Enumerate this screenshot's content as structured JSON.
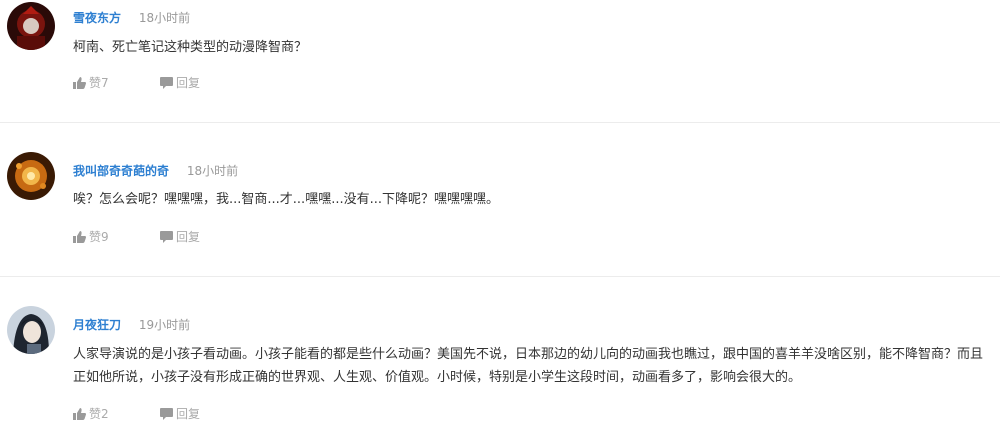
{
  "comments": [
    {
      "username": "雪夜东方",
      "time": "18小时前",
      "text": "柯南、死亡笔记这种类型的动漫降智商？",
      "like_label": "赞7",
      "reply_label": "回复"
    },
    {
      "username": "我叫部奇奇葩的奇",
      "time": "18小时前",
      "text": "唉？怎么会呢？嘿嘿嘿，我...智商...才...嘿嘿...没有...下降呢？嘿嘿嘿嘿。",
      "like_label": "赞9",
      "reply_label": "回复"
    },
    {
      "username": "月夜狂刀",
      "time": "19小时前",
      "text": "人家导演说的是小孩子看动画。小孩子能看的都是些什么动画？美国先不说，日本那边的幼儿向的动画我也瞧过，跟中国的喜羊羊没啥区别，能不降智商？而且正如他所说，小孩子没有形成正确的世界观、人生观、价值观。小时候，特别是小学生这段时间，动画看多了，影响会很大的。",
      "like_label": "赞2",
      "reply_label": "回复"
    }
  ],
  "icons": {
    "like": "thumbs-up-icon",
    "reply": "speech-bubble-icon"
  },
  "colors": {
    "username": "#2d7fd1",
    "meta": "#999999",
    "action": "#aaaaaa",
    "divider": "#ececec"
  }
}
